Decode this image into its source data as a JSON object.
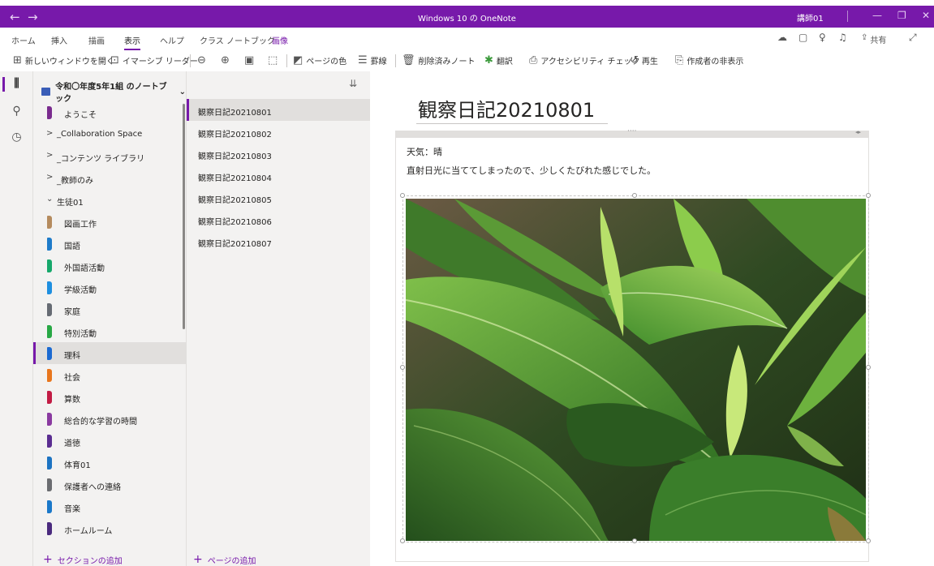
{
  "titlebar": {
    "back": "←",
    "forward": "→",
    "title": "Windows 10 の OneNote",
    "user": "講師01",
    "minimize": "—",
    "restore": "❐",
    "close": "✕"
  },
  "menu": {
    "items": [
      "ホーム",
      "挿入",
      "描画",
      "表示",
      "ヘルプ",
      "クラス ノートブック",
      "画像"
    ],
    "active_index": 3,
    "contextual_index": 6,
    "share_label": "共有"
  },
  "toolbar": {
    "new_window": "新しいウィンドウを開く",
    "immersive_reader": "イマーシブ リーダー",
    "page_color": "ページの色",
    "rule_lines": "罫線",
    "deleted_notes": "削除済みノート",
    "translate": "翻訳",
    "accessibility": "アクセシビリティ チェック",
    "replay": "再生",
    "hide_authors": "作成者の非表示"
  },
  "notebook": {
    "title": "令和〇年度5年1組 のノートブック",
    "chevron": "⌄"
  },
  "sections": [
    {
      "label": "ようこそ",
      "kind": "section",
      "color": "#7a2b8e"
    },
    {
      "label": "_Collaboration Space",
      "kind": "group",
      "chevron": ">"
    },
    {
      "label": "_コンテンツ ライブラリ",
      "kind": "group",
      "chevron": ">"
    },
    {
      "label": "_教師のみ",
      "kind": "group",
      "chevron": ">"
    },
    {
      "label": "生徒01",
      "kind": "group-open",
      "chevron": "⌄"
    },
    {
      "label": "図画工作",
      "kind": "section",
      "color": "#b58b5e"
    },
    {
      "label": "国語",
      "kind": "section",
      "color": "#1e7bc9"
    },
    {
      "label": "外国語活動",
      "kind": "section",
      "color": "#16a86b"
    },
    {
      "label": "学級活動",
      "kind": "section",
      "color": "#1e8fe0"
    },
    {
      "label": "家庭",
      "kind": "section",
      "color": "#666b73"
    },
    {
      "label": "特別活動",
      "kind": "section",
      "color": "#28a845"
    },
    {
      "label": "理科",
      "kind": "section",
      "color": "#1b6ad1",
      "selected": true
    },
    {
      "label": "社会",
      "kind": "section",
      "color": "#e8761d"
    },
    {
      "label": "算数",
      "kind": "section",
      "color": "#c21b44"
    },
    {
      "label": "総合的な学習の時間",
      "kind": "section",
      "color": "#8a3aa0"
    },
    {
      "label": "道徳",
      "kind": "section",
      "color": "#5a2d91"
    },
    {
      "label": "体育01",
      "kind": "section",
      "color": "#1c73c2"
    },
    {
      "label": "保護者への連絡",
      "kind": "section",
      "color": "#6a6c70"
    },
    {
      "label": "音楽",
      "kind": "section",
      "color": "#1a78c9"
    },
    {
      "label": "ホームルーム",
      "kind": "section",
      "color": "#4a2a7e"
    }
  ],
  "add_section": "セクションの追加",
  "pages": [
    {
      "label": "観察日記20210801",
      "selected": true
    },
    {
      "label": "観察日記20210802"
    },
    {
      "label": "観察日記20210803"
    },
    {
      "label": "観察日記20210804"
    },
    {
      "label": "観察日記20210805"
    },
    {
      "label": "観察日記20210806"
    },
    {
      "label": "観察日記20210807"
    }
  ],
  "add_page": "ページの追加",
  "note": {
    "title": "観察日記20210801",
    "lines": [
      "天気：晴",
      "直射日光に当ててしまったので、少しくたびれた感じでした。"
    ]
  },
  "colors": {
    "accent": "#7719aa",
    "pane_bg": "#f3f2f1",
    "selected_bg": "#e1dfdd"
  }
}
